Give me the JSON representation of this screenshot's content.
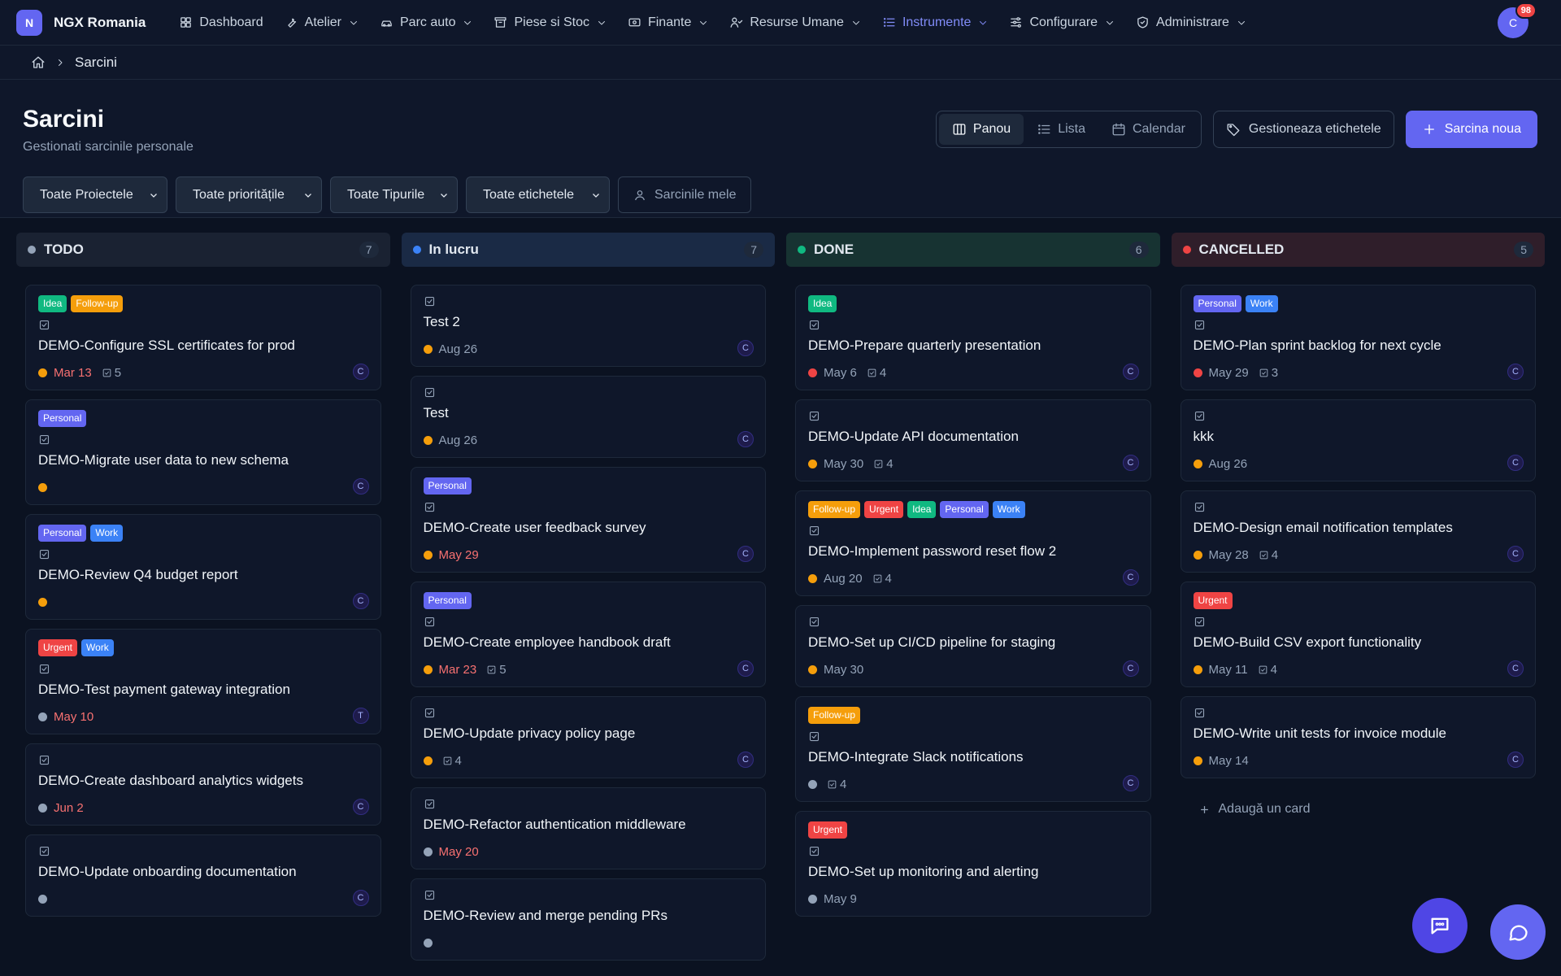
{
  "nav": {
    "logo_letter": "N",
    "brand": "NGX Romania",
    "items": [
      {
        "label": "Dashboard",
        "icon": "grid-icon",
        "dropdown": false,
        "active": false
      },
      {
        "label": "Atelier",
        "icon": "wrench-icon",
        "dropdown": true,
        "active": false
      },
      {
        "label": "Parc auto",
        "icon": "car-icon",
        "dropdown": true,
        "active": false
      },
      {
        "label": "Piese si Stoc",
        "icon": "archive-icon",
        "dropdown": true,
        "active": false
      },
      {
        "label": "Finante",
        "icon": "banknote-icon",
        "dropdown": true,
        "active": false
      },
      {
        "label": "Resurse Umane",
        "icon": "users-icon",
        "dropdown": true,
        "active": false
      },
      {
        "label": "Instrumente",
        "icon": "list-icon",
        "dropdown": true,
        "active": true
      },
      {
        "label": "Configurare",
        "icon": "sliders-icon",
        "dropdown": true,
        "active": false
      },
      {
        "label": "Administrare",
        "icon": "shield-icon",
        "dropdown": true,
        "active": false
      }
    ],
    "avatar_letter": "C",
    "notification_count": "98"
  },
  "breadcrumb": {
    "current": "Sarcini"
  },
  "header": {
    "title": "Sarcini",
    "subtitle": "Gestionati sarcinile personale",
    "views": [
      {
        "label": "Panou",
        "icon": "columns-icon",
        "active": true
      },
      {
        "label": "Lista",
        "icon": "list-icon",
        "active": false
      },
      {
        "label": "Calendar",
        "icon": "calendar-icon",
        "active": false
      }
    ],
    "manage_labels": "Gestioneaza etichetele",
    "new_task": "Sarcina noua"
  },
  "filters": {
    "project": "Toate Proiectele",
    "priority": "Toate prioritățile",
    "type": "Toate Tipurile",
    "labels": "Toate etichetele",
    "my_tasks": "Sarcinile mele"
  },
  "colors": {
    "Idea": "#10b981",
    "Follow-up": "#f59e0b",
    "Personal": "#6366f1",
    "Work": "#3b82f6",
    "Urgent": "#ef4444",
    "orange": "#f59e0b",
    "red": "#ef4444",
    "gray": "#94a3b8"
  },
  "columns": [
    {
      "title": "TODO",
      "count": "7",
      "dot": "#94a3b8",
      "bg": "#1a2232",
      "cards": [
        {
          "tags": [
            "Idea",
            "Follow-up"
          ],
          "title": "DEMO-Configure SSL certificates for prod",
          "priority": "orange",
          "date": "Mar 13",
          "date_red": true,
          "subtasks": "5",
          "assignee": "C"
        },
        {
          "tags": [
            "Personal"
          ],
          "title": "DEMO-Migrate user data to new schema",
          "priority": "orange",
          "date": "",
          "date_red": false,
          "subtasks": "",
          "assignee": "C"
        },
        {
          "tags": [
            "Personal",
            "Work"
          ],
          "title": "DEMO-Review Q4 budget report",
          "priority": "orange",
          "date": "",
          "date_red": false,
          "subtasks": "",
          "assignee": "C"
        },
        {
          "tags": [
            "Urgent",
            "Work"
          ],
          "title": "DEMO-Test payment gateway integration",
          "priority": "gray",
          "date": "May 10",
          "date_red": true,
          "subtasks": "",
          "assignee": "T"
        },
        {
          "tags": [],
          "title": "DEMO-Create dashboard analytics widgets",
          "priority": "gray",
          "date": "Jun 2",
          "date_red": true,
          "subtasks": "",
          "assignee": "C"
        },
        {
          "tags": [],
          "title": "DEMO-Update onboarding documentation",
          "priority": "gray",
          "date": "",
          "date_red": false,
          "subtasks": "",
          "assignee": "C"
        }
      ]
    },
    {
      "title": "In lucru",
      "count": "7",
      "dot": "#3b82f6",
      "bg": "#1a2a45",
      "cards": [
        {
          "tags": [],
          "title": "Test 2",
          "priority": "orange",
          "date": "Aug 26",
          "date_red": false,
          "subtasks": "",
          "assignee": "C"
        },
        {
          "tags": [],
          "title": "Test",
          "priority": "orange",
          "date": "Aug 26",
          "date_red": false,
          "subtasks": "",
          "assignee": "C"
        },
        {
          "tags": [
            "Personal"
          ],
          "title": "DEMO-Create user feedback survey",
          "priority": "orange",
          "date": "May 29",
          "date_red": true,
          "subtasks": "",
          "assignee": "C"
        },
        {
          "tags": [
            "Personal"
          ],
          "title": "DEMO-Create employee handbook draft",
          "priority": "orange",
          "date": "Mar 23",
          "date_red": true,
          "subtasks": "5",
          "assignee": "C"
        },
        {
          "tags": [],
          "title": "DEMO-Update privacy policy page",
          "priority": "orange",
          "date": "",
          "date_red": false,
          "subtasks": "4",
          "assignee": "C"
        },
        {
          "tags": [],
          "title": "DEMO-Refactor authentication middleware",
          "priority": "gray",
          "date": "May 20",
          "date_red": true,
          "subtasks": "",
          "assignee": ""
        },
        {
          "tags": [],
          "title": "DEMO-Review and merge pending PRs",
          "priority": "gray",
          "date": "",
          "date_red": false,
          "subtasks": "",
          "assignee": ""
        }
      ]
    },
    {
      "title": "DONE",
      "count": "6",
      "dot": "#10b981",
      "bg": "#173332",
      "cards": [
        {
          "tags": [
            "Idea"
          ],
          "title": "DEMO-Prepare quarterly presentation",
          "priority": "red",
          "date": "May 6",
          "date_red": false,
          "subtasks": "4",
          "assignee": "C"
        },
        {
          "tags": [],
          "title": "DEMO-Update API documentation",
          "priority": "orange",
          "date": "May 30",
          "date_red": false,
          "subtasks": "4",
          "assignee": "C"
        },
        {
          "tags": [
            "Follow-up",
            "Urgent",
            "Idea",
            "Personal",
            "Work"
          ],
          "title": "DEMO-Implement password reset flow 2",
          "priority": "orange",
          "date": "Aug 20",
          "date_red": false,
          "subtasks": "4",
          "assignee": "C"
        },
        {
          "tags": [],
          "title": "DEMO-Set up CI/CD pipeline for staging",
          "priority": "orange",
          "date": "May 30",
          "date_red": false,
          "subtasks": "",
          "assignee": "C"
        },
        {
          "tags": [
            "Follow-up"
          ],
          "title": "DEMO-Integrate Slack notifications",
          "priority": "gray",
          "date": "",
          "date_red": false,
          "subtasks": "4",
          "assignee": "C"
        },
        {
          "tags": [
            "Urgent"
          ],
          "title": "DEMO-Set up monitoring and alerting",
          "priority": "gray",
          "date": "May 9",
          "date_red": false,
          "subtasks": "",
          "assignee": ""
        }
      ]
    },
    {
      "title": "CANCELLED",
      "count": "5",
      "dot": "#ef4444",
      "bg": "#2f1e2a",
      "cards": [
        {
          "tags": [
            "Personal",
            "Work"
          ],
          "title": "DEMO-Plan sprint backlog for next cycle",
          "priority": "red",
          "date": "May 29",
          "date_red": false,
          "subtasks": "3",
          "assignee": "C"
        },
        {
          "tags": [],
          "title": "kkk",
          "priority": "orange",
          "date": "Aug 26",
          "date_red": false,
          "subtasks": "",
          "assignee": "C"
        },
        {
          "tags": [],
          "title": "DEMO-Design email notification templates",
          "priority": "orange",
          "date": "May 28",
          "date_red": false,
          "subtasks": "4",
          "assignee": "C"
        },
        {
          "tags": [
            "Urgent"
          ],
          "title": "DEMO-Build CSV export functionality",
          "priority": "orange",
          "date": "May 11",
          "date_red": false,
          "subtasks": "4",
          "assignee": "C"
        },
        {
          "tags": [],
          "title": "DEMO-Write unit tests for invoice module",
          "priority": "orange",
          "date": "May 14",
          "date_red": false,
          "subtasks": "",
          "assignee": "C"
        }
      ],
      "add_card": "Adaugă un card"
    }
  ]
}
